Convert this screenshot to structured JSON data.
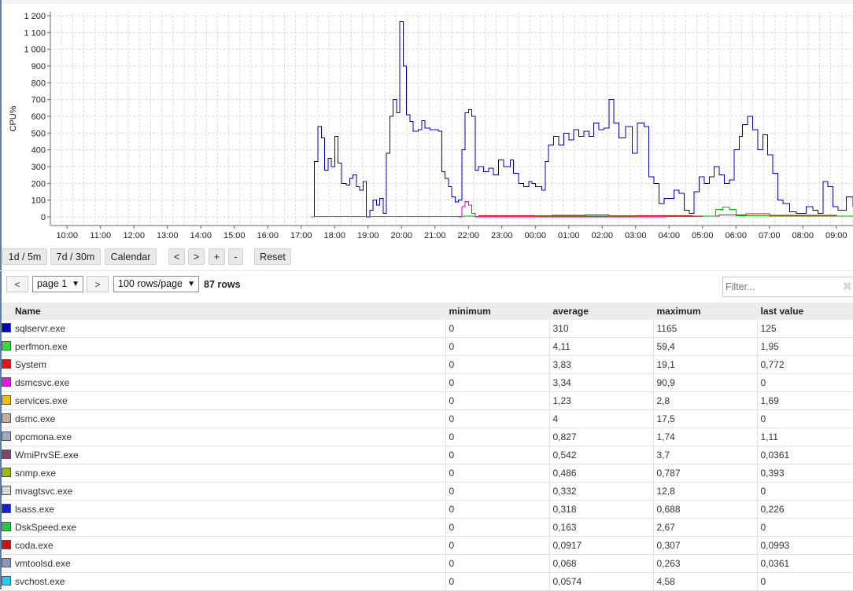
{
  "chart_data": {
    "type": "line",
    "ylabel": "CPU%",
    "ylim": [
      0,
      1200
    ],
    "y_ticks": [
      "1 200",
      "1 100",
      "1 000",
      "900",
      "800",
      "700",
      "600",
      "500",
      "400",
      "300",
      "200",
      "100",
      "0"
    ],
    "x_ticks": [
      "10:00",
      "11:00",
      "12:00",
      "13:00",
      "14:00",
      "15:00",
      "16:00",
      "17:00",
      "18:00",
      "19:00",
      "20:00",
      "21:00",
      "22:00",
      "23:00",
      "00:00",
      "01:00",
      "02:00",
      "03:00",
      "04:00",
      "05:00",
      "06:00",
      "07:00",
      "08:00",
      "09:00"
    ],
    "x_range_hours": [
      9.5,
      33.5
    ],
    "grid": true,
    "series": [
      {
        "name": "sqlservr.exe",
        "color": "#0000c0",
        "points": [
          [
            17.3,
            0
          ],
          [
            17.4,
            330
          ],
          [
            17.5,
            540
          ],
          [
            17.6,
            470
          ],
          [
            17.7,
            280
          ],
          [
            17.8,
            350
          ],
          [
            17.9,
            300
          ],
          [
            18.0,
            480
          ],
          [
            18.1,
            320
          ],
          [
            18.2,
            200
          ],
          [
            18.35,
            190
          ],
          [
            18.45,
            230
          ],
          [
            18.55,
            250
          ],
          [
            18.65,
            180
          ],
          [
            18.75,
            160
          ],
          [
            18.85,
            210
          ],
          [
            18.95,
            0
          ],
          [
            19.05,
            40
          ],
          [
            19.15,
            100
          ],
          [
            19.25,
            70
          ],
          [
            19.35,
            110
          ],
          [
            19.45,
            20
          ],
          [
            19.55,
            380
          ],
          [
            19.65,
            600
          ],
          [
            19.75,
            700
          ],
          [
            19.85,
            620
          ],
          [
            19.95,
            1165
          ],
          [
            20.05,
            900
          ],
          [
            20.15,
            610
          ],
          [
            20.25,
            570
          ],
          [
            20.35,
            510
          ],
          [
            20.5,
            520
          ],
          [
            20.6,
            575
          ],
          [
            20.7,
            530
          ],
          [
            20.85,
            520
          ],
          [
            21.0,
            520
          ],
          [
            21.1,
            510
          ],
          [
            21.2,
            270
          ],
          [
            21.3,
            230
          ],
          [
            21.4,
            180
          ],
          [
            21.5,
            120
          ],
          [
            21.6,
            90
          ],
          [
            21.7,
            100
          ],
          [
            21.8,
            400
          ],
          [
            21.9,
            620
          ],
          [
            22.0,
            640
          ],
          [
            22.1,
            600
          ],
          [
            22.2,
            280
          ],
          [
            22.3,
            300
          ],
          [
            22.45,
            270
          ],
          [
            22.6,
            290
          ],
          [
            22.75,
            250
          ],
          [
            22.9,
            340
          ],
          [
            23.05,
            300
          ],
          [
            23.25,
            340
          ],
          [
            23.35,
            260
          ],
          [
            23.5,
            200
          ],
          [
            23.65,
            180
          ],
          [
            23.8,
            210
          ],
          [
            23.9,
            200
          ],
          [
            24.0,
            180
          ],
          [
            24.2,
            160
          ],
          [
            24.3,
            330
          ],
          [
            24.4,
            430
          ],
          [
            24.55,
            480
          ],
          [
            24.7,
            430
          ],
          [
            24.85,
            500
          ],
          [
            25.0,
            460
          ],
          [
            25.15,
            520
          ],
          [
            25.3,
            480
          ],
          [
            25.45,
            510
          ],
          [
            25.6,
            480
          ],
          [
            25.75,
            560
          ],
          [
            25.9,
            520
          ],
          [
            26.05,
            530
          ],
          [
            26.2,
            700
          ],
          [
            26.35,
            560
          ],
          [
            26.5,
            470
          ],
          [
            26.7,
            540
          ],
          [
            26.9,
            380
          ],
          [
            27.05,
            560
          ],
          [
            27.25,
            540
          ],
          [
            27.4,
            240
          ],
          [
            27.55,
            200
          ],
          [
            27.7,
            80
          ],
          [
            27.85,
            110
          ],
          [
            28.0,
            110
          ],
          [
            28.15,
            160
          ],
          [
            28.3,
            140
          ],
          [
            28.45,
            40
          ],
          [
            28.6,
            20
          ],
          [
            28.75,
            150
          ],
          [
            28.9,
            240
          ],
          [
            29.05,
            200
          ],
          [
            29.2,
            240
          ],
          [
            29.35,
            300
          ],
          [
            29.5,
            250
          ],
          [
            29.65,
            200
          ],
          [
            29.8,
            220
          ],
          [
            29.95,
            400
          ],
          [
            30.1,
            480
          ],
          [
            30.2,
            550
          ],
          [
            30.35,
            600
          ],
          [
            30.5,
            520
          ],
          [
            30.65,
            400
          ],
          [
            30.8,
            490
          ],
          [
            30.95,
            370
          ],
          [
            31.1,
            260
          ],
          [
            31.25,
            100
          ],
          [
            31.4,
            80
          ],
          [
            31.6,
            30
          ],
          [
            31.8,
            20
          ],
          [
            31.95,
            20
          ],
          [
            32.1,
            60
          ],
          [
            32.3,
            40
          ],
          [
            32.45,
            20
          ],
          [
            32.6,
            210
          ],
          [
            32.75,
            180
          ],
          [
            32.9,
            60
          ],
          [
            33.05,
            40
          ],
          [
            33.3,
            120
          ],
          [
            33.5,
            60
          ]
        ]
      },
      {
        "name": "perfmon.exe",
        "color": "#00c000",
        "points": [
          [
            17.3,
            0
          ],
          [
            17.4,
            3
          ],
          [
            19.6,
            2
          ],
          [
            21.8,
            4
          ],
          [
            22.2,
            2
          ],
          [
            24.0,
            4
          ],
          [
            27.0,
            3
          ],
          [
            29.0,
            5
          ],
          [
            29.4,
            45
          ],
          [
            29.6,
            59
          ],
          [
            29.8,
            45
          ],
          [
            30.0,
            8
          ],
          [
            31.0,
            4
          ],
          [
            33.5,
            5
          ]
        ]
      },
      {
        "name": "dsmcsvc.exe",
        "color": "#e000e0",
        "points": [
          [
            21.7,
            0
          ],
          [
            21.8,
            60
          ],
          [
            21.9,
            91
          ],
          [
            22.0,
            70
          ],
          [
            22.1,
            20
          ],
          [
            22.2,
            0
          ],
          [
            27.9,
            0
          ]
        ]
      },
      {
        "name": "System",
        "color": "#e00000",
        "points": [
          [
            22.3,
            8
          ],
          [
            24.5,
            10
          ],
          [
            25.5,
            12
          ],
          [
            26.2,
            6
          ],
          [
            28.7,
            4
          ],
          [
            29.5,
            12
          ],
          [
            30.3,
            19
          ],
          [
            31.0,
            10
          ],
          [
            33.0,
            4
          ]
        ]
      }
    ]
  },
  "controls": {
    "range1": "1d / 5m",
    "range2": "7d / 30m",
    "calendar": "Calendar",
    "prev": "<",
    "next": ">",
    "zoom_in": "+",
    "zoom_out": "-",
    "reset": "Reset"
  },
  "pager": {
    "prev": "<",
    "page": "page 1",
    "next": ">",
    "page_size": "100 rows/page",
    "row_count": "87 rows",
    "filter_placeholder": "Filter..."
  },
  "table": {
    "columns": [
      "Name",
      "minimum",
      "average",
      "maximum",
      "last value"
    ],
    "rows": [
      {
        "color": "#0000c0",
        "name": "sqlservr.exe",
        "min": "0",
        "avg": "310",
        "max": "1165",
        "last": "125"
      },
      {
        "color": "#33dd33",
        "name": "perfmon.exe",
        "min": "0",
        "avg": "4,11",
        "max": "59,4",
        "last": "1,95"
      },
      {
        "color": "#ee1111",
        "name": "System",
        "min": "0",
        "avg": "3,83",
        "max": "19,1",
        "last": "0,772"
      },
      {
        "color": "#ee11ee",
        "name": "dsmcsvc.exe",
        "min": "0",
        "avg": "3,34",
        "max": "90,9",
        "last": "0"
      },
      {
        "color": "#f0c000",
        "name": "services.exe",
        "min": "0",
        "avg": "1,23",
        "max": "2,8",
        "last": "1,69"
      },
      {
        "color": "#c8aaa0",
        "name": "dsmc.exe",
        "min": "0",
        "avg": "4",
        "max": "17,5",
        "last": "0"
      },
      {
        "color": "#a0a8c8",
        "name": "opcmona.exe",
        "min": "0",
        "avg": "0,827",
        "max": "1,74",
        "last": "1,11"
      },
      {
        "color": "#884466",
        "name": "WmiPrvSE.exe",
        "min": "0",
        "avg": "0,542",
        "max": "3,7",
        "last": "0,0361"
      },
      {
        "color": "#99bb11",
        "name": "snmp.exe",
        "min": "0",
        "avg": "0,486",
        "max": "0,787",
        "last": "0,393"
      },
      {
        "color": "#d8d8d8",
        "name": "mvagtsvc.exe",
        "min": "0",
        "avg": "0,332",
        "max": "12,8",
        "last": "0"
      },
      {
        "color": "#1122cc",
        "name": "lsass.exe",
        "min": "0",
        "avg": "0,318",
        "max": "0,688",
        "last": "0,226"
      },
      {
        "color": "#22cc44",
        "name": "DskSpeed.exe",
        "min": "0",
        "avg": "0,163",
        "max": "2,67",
        "last": "0"
      },
      {
        "color": "#cc1111",
        "name": "coda.exe",
        "min": "0",
        "avg": "0,0917",
        "max": "0,307",
        "last": "0,0993"
      },
      {
        "color": "#8899bb",
        "name": "vmtoolsd.exe",
        "min": "0",
        "avg": "0,068",
        "max": "0,263",
        "last": "0,0361"
      },
      {
        "color": "#22ccee",
        "name": "svchost.exe",
        "min": "0",
        "avg": "0,0574",
        "max": "4,58",
        "last": "0"
      }
    ]
  }
}
